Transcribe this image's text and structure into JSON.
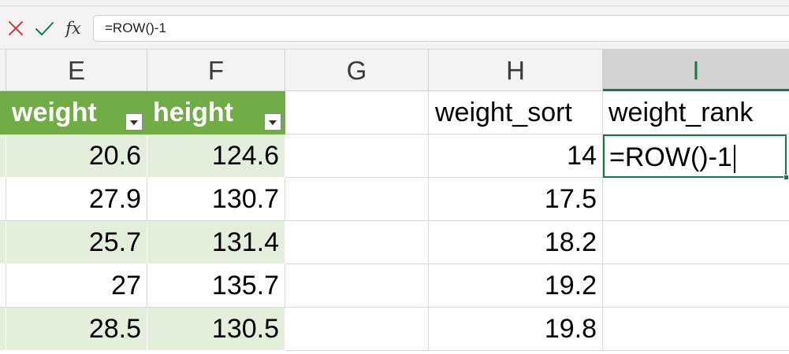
{
  "formula_bar": {
    "cancel_icon": "x-icon",
    "enter_icon": "check-icon",
    "fx_label": "fx",
    "formula": "=ROW()-1"
  },
  "columns": [
    {
      "letter": "E"
    },
    {
      "letter": "F"
    },
    {
      "letter": "G"
    },
    {
      "letter": "H"
    },
    {
      "letter": "I",
      "active": true
    }
  ],
  "table": {
    "headers": {
      "weight": "weight",
      "height": "height"
    },
    "rows": [
      {
        "weight": "20.6",
        "height": "124.6"
      },
      {
        "weight": "27.9",
        "height": "130.7"
      },
      {
        "weight": "25.7",
        "height": "131.4"
      },
      {
        "weight": "27",
        "height": "135.7"
      },
      {
        "weight": "28.5",
        "height": "130.5"
      }
    ]
  },
  "sort_column": {
    "header": "weight_sort",
    "values": [
      "14",
      "17.5",
      "18.2",
      "19.2",
      "19.8"
    ]
  },
  "rank_column": {
    "header": "weight_rank",
    "editing_value": "=ROW()-1"
  },
  "colors": {
    "table_header": "#70ad47",
    "table_band": "#e2efda",
    "accent": "#107c41",
    "cancel": "#d83b3b",
    "enter": "#107c41"
  }
}
